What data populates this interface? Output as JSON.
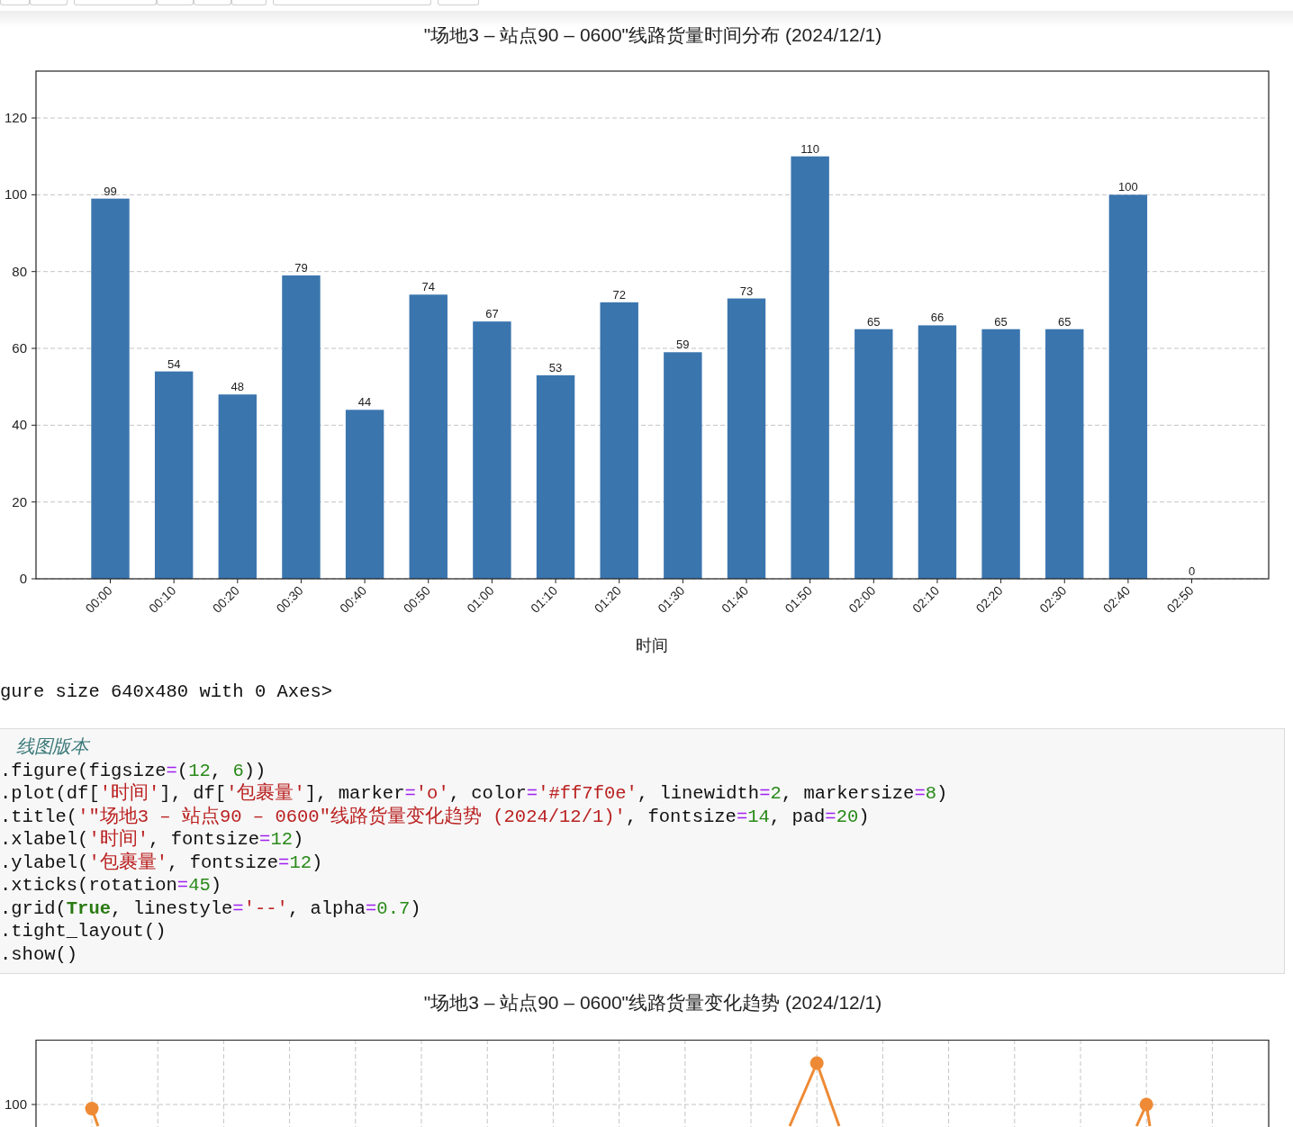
{
  "bar_chart": {
    "chart_data": {
      "type": "bar",
      "title": "\"场地3 – 站点90 – 0600\"线路货量时间分布 (2024/12/1)",
      "xlabel": "时间",
      "categories": [
        "00:00",
        "00:10",
        "00:20",
        "00:30",
        "00:40",
        "00:50",
        "01:00",
        "01:10",
        "01:20",
        "01:30",
        "01:40",
        "01:50",
        "02:00",
        "02:10",
        "02:20",
        "02:30",
        "02:40",
        "02:50"
      ],
      "values": [
        99,
        54,
        48,
        79,
        44,
        74,
        67,
        53,
        72,
        59,
        73,
        110,
        65,
        66,
        65,
        65,
        100,
        0
      ],
      "grid": true,
      "ylim": [
        0,
        132.2
      ],
      "yticks": [
        0,
        20,
        40,
        60,
        80,
        100,
        120
      ],
      "data_labels": true
    }
  },
  "output_text": "gure size 640x480 with 0 Axes>",
  "code_cell": {
    "lines": [
      [
        {
          "kind": "comment",
          "text": "线图版本"
        }
      ],
      [
        {
          "kind": "plain",
          "text": ".figure(figsize"
        },
        {
          "kind": "op",
          "text": "="
        },
        {
          "kind": "plain",
          "text": "("
        },
        {
          "kind": "num",
          "text": "12"
        },
        {
          "kind": "plain",
          "text": ", "
        },
        {
          "kind": "num",
          "text": "6"
        },
        {
          "kind": "plain",
          "text": "))"
        }
      ],
      [
        {
          "kind": "plain",
          "text": ".plot(df["
        },
        {
          "kind": "str",
          "text": "'时间'"
        },
        {
          "kind": "plain",
          "text": "], df["
        },
        {
          "kind": "str",
          "text": "'包裹量'"
        },
        {
          "kind": "plain",
          "text": "], marker"
        },
        {
          "kind": "op",
          "text": "="
        },
        {
          "kind": "str",
          "text": "'o'"
        },
        {
          "kind": "plain",
          "text": ", color"
        },
        {
          "kind": "op",
          "text": "="
        },
        {
          "kind": "str",
          "text": "'#ff7f0e'"
        },
        {
          "kind": "plain",
          "text": ", linewidth"
        },
        {
          "kind": "op",
          "text": "="
        },
        {
          "kind": "num",
          "text": "2"
        },
        {
          "kind": "plain",
          "text": ", markersize"
        },
        {
          "kind": "op",
          "text": "="
        },
        {
          "kind": "num",
          "text": "8"
        },
        {
          "kind": "plain",
          "text": ")"
        }
      ],
      [
        {
          "kind": "plain",
          "text": ".title("
        },
        {
          "kind": "str",
          "text": "'\"场地3 – 站点90 – 0600\"线路货量变化趋势 (2024/12/1)'"
        },
        {
          "kind": "plain",
          "text": ", fontsize"
        },
        {
          "kind": "op",
          "text": "="
        },
        {
          "kind": "num",
          "text": "14"
        },
        {
          "kind": "plain",
          "text": ", pad"
        },
        {
          "kind": "op",
          "text": "="
        },
        {
          "kind": "num",
          "text": "20"
        },
        {
          "kind": "plain",
          "text": ")"
        }
      ],
      [
        {
          "kind": "plain",
          "text": ".xlabel("
        },
        {
          "kind": "str",
          "text": "'时间'"
        },
        {
          "kind": "plain",
          "text": ", fontsize"
        },
        {
          "kind": "op",
          "text": "="
        },
        {
          "kind": "num",
          "text": "12"
        },
        {
          "kind": "plain",
          "text": ")"
        }
      ],
      [
        {
          "kind": "plain",
          "text": ".ylabel("
        },
        {
          "kind": "str",
          "text": "'包裹量'"
        },
        {
          "kind": "plain",
          "text": ", fontsize"
        },
        {
          "kind": "op",
          "text": "="
        },
        {
          "kind": "num",
          "text": "12"
        },
        {
          "kind": "plain",
          "text": ")"
        }
      ],
      [
        {
          "kind": "plain",
          "text": ".xticks(rotation"
        },
        {
          "kind": "op",
          "text": "="
        },
        {
          "kind": "num",
          "text": "45"
        },
        {
          "kind": "plain",
          "text": ")"
        }
      ],
      [
        {
          "kind": "plain",
          "text": ".grid("
        },
        {
          "kind": "kw",
          "text": "True"
        },
        {
          "kind": "plain",
          "text": ", linestyle"
        },
        {
          "kind": "op",
          "text": "="
        },
        {
          "kind": "str",
          "text": "'--'"
        },
        {
          "kind": "plain",
          "text": ", alpha"
        },
        {
          "kind": "op",
          "text": "="
        },
        {
          "kind": "num",
          "text": "0.7"
        },
        {
          "kind": "plain",
          "text": ")"
        }
      ],
      [
        {
          "kind": "plain",
          "text": ".tight_layout()"
        }
      ],
      [
        {
          "kind": "plain",
          "text": ".show()"
        }
      ]
    ]
  },
  "line_chart": {
    "title": "\"场地3 – 站点90 – 0600\"线路货量变化趋势 (2024/12/1)",
    "ytick_label": "100"
  }
}
